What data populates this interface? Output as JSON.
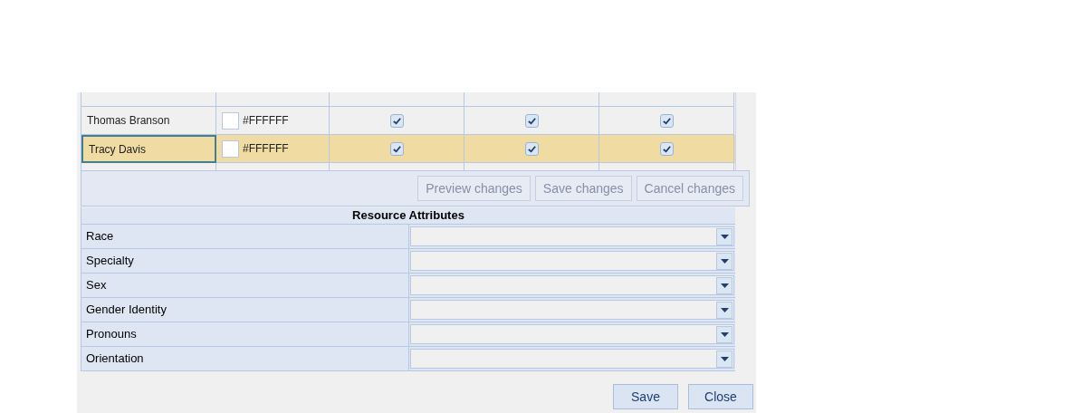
{
  "resources": {
    "rows": [
      {
        "name": "Thomas Branson",
        "color_value": "#FFFFFF",
        "checks": [
          true,
          true,
          true
        ],
        "selected": false
      },
      {
        "name": "Tracy Davis",
        "color_value": "#FFFFFF",
        "checks": [
          true,
          true,
          true
        ],
        "selected": true
      }
    ],
    "buttons": [
      {
        "label": "Preview changes",
        "disabled": true
      },
      {
        "label": "Save changes",
        "disabled": true
      },
      {
        "label": "Cancel changes",
        "disabled": true
      }
    ]
  },
  "attributes": {
    "title": "Resource Attributes",
    "rows": [
      {
        "label": "Race"
      },
      {
        "label": "Specialty"
      },
      {
        "label": "Sex"
      },
      {
        "label": "Gender Identity"
      },
      {
        "label": "Pronouns"
      },
      {
        "label": "Orientation"
      }
    ]
  },
  "footer_buttons": [
    "Save",
    "Close"
  ]
}
